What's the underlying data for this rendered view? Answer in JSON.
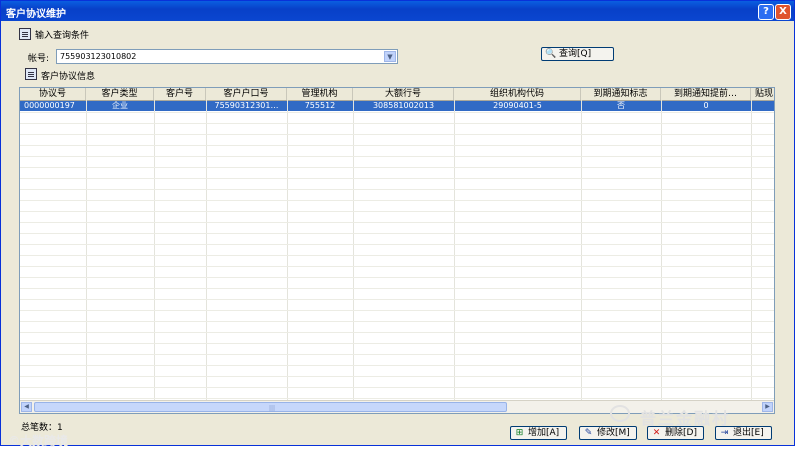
{
  "window": {
    "title": "客户协议维护",
    "help_label": "?",
    "close_label": "X"
  },
  "query_section": {
    "title": "输入查询条件",
    "account_label": "帐号:",
    "account_value": "755903123010802",
    "query_button": "查询[Q]"
  },
  "info_section": {
    "title": "客户协议信息"
  },
  "table": {
    "columns": [
      "协议号",
      "客户类型",
      "客户号",
      "客户户口号",
      "管理机构",
      "大额行号",
      "组织机构代码",
      "到期通知标志",
      "到期通知提前…",
      "贴现"
    ],
    "rows": [
      [
        "0000000197",
        "企业",
        "",
        "75590312301…",
        "755512",
        "308581002013",
        "29090401-5",
        "否",
        "0",
        ""
      ]
    ]
  },
  "status": {
    "total_label": "总笔数：1"
  },
  "buttons": {
    "add": "增加[A]",
    "modify": "修改[M]",
    "delete": "删除[D]",
    "exit": "退出[E]"
  },
  "watermarks": {
    "left": "©大数跨境",
    "right": "普兰金融村"
  },
  "colors": {
    "title_bar": "#0a46d0",
    "selection": "#316ac5",
    "window_bg": "#ece9d8"
  }
}
